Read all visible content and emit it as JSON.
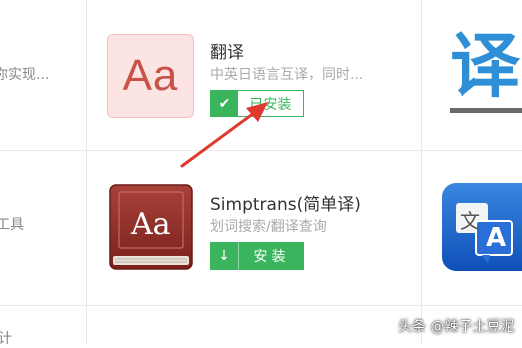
{
  "left_column": {
    "row1_text": "你实现...",
    "row2_text": "工具",
    "row3_text": "计"
  },
  "apps": [
    {
      "icon_text": "Aa",
      "title": "翻译",
      "description": "中英日语言互译，同时...",
      "button_label": "已安装",
      "button_icon": "check-icon",
      "status": "installed"
    },
    {
      "icon_text": "Aa",
      "title": "Simptrans(简单译)",
      "description": "划词搜索/翻译查询",
      "button_label": "安装",
      "button_icon": "download-icon",
      "status": "not-installed"
    }
  ],
  "right_column": {
    "big_icon_char": "译",
    "translate_icon_chars": [
      "文",
      "A"
    ]
  },
  "watermark": "头条 @辣子土豆泥",
  "colors": {
    "accent_green": "#3ab55e",
    "arrow_red": "#e03a2f",
    "blue_icon": "#2e8fd6"
  }
}
